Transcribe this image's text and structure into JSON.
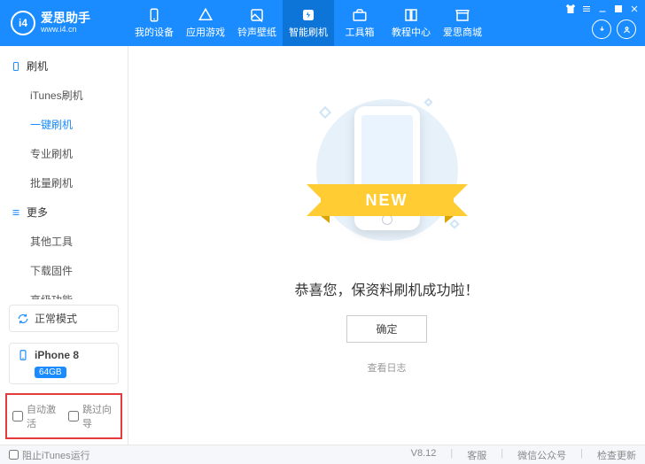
{
  "header": {
    "logo_text": "爱思助手",
    "logo_sub": "www.i4.cn",
    "logo_badge": "i4",
    "nav": [
      {
        "label": "我的设备"
      },
      {
        "label": "应用游戏"
      },
      {
        "label": "铃声壁纸"
      },
      {
        "label": "智能刷机"
      },
      {
        "label": "工具箱"
      },
      {
        "label": "教程中心"
      },
      {
        "label": "爱思商城"
      }
    ]
  },
  "sidebar": {
    "group1": "刷机",
    "items1": [
      "iTunes刷机",
      "一键刷机",
      "专业刷机",
      "批量刷机"
    ],
    "group2": "更多",
    "items2": [
      "其他工具",
      "下载固件",
      "高级功能"
    ],
    "mode": "正常模式",
    "device_name": "iPhone 8",
    "device_badge": "64GB",
    "opts": [
      "自动激活",
      "跳过向导"
    ]
  },
  "main": {
    "ribbon": "NEW",
    "success": "恭喜您，保资料刷机成功啦！",
    "ok": "确定",
    "log": "查看日志"
  },
  "footer": {
    "block_itunes": "阻止iTunes运行",
    "version": "V8.12",
    "links": [
      "客服",
      "微信公众号",
      "检查更新"
    ]
  }
}
